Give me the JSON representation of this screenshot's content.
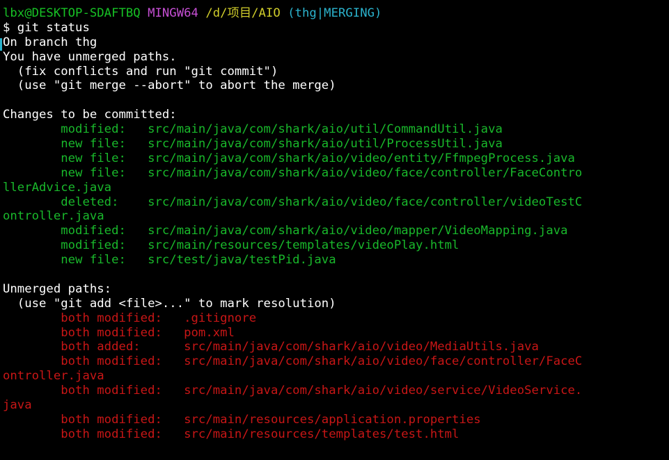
{
  "prompt": {
    "user_host": "lbx@DESKTOP-SDAFTBQ",
    "system": "MINGW64",
    "path": "/d/项目/AIO",
    "branch_status": "(thg|MERGING)"
  },
  "command": "$ git status",
  "info": [
    "On branch thg",
    "You have unmerged paths.",
    "  (fix conflicts and run \"git commit\")",
    "  (use \"git merge --abort\" to abort the merge)"
  ],
  "staged": {
    "heading": "Changes to be committed:",
    "lines": [
      "        modified:   src/main/java/com/shark/aio/util/CommandUtil.java",
      "        new file:   src/main/java/com/shark/aio/util/ProcessUtil.java",
      "        new file:   src/main/java/com/shark/aio/video/entity/FfmpegProcess.java",
      "        new file:   src/main/java/com/shark/aio/video/face/controller/FaceContro",
      "llerAdvice.java",
      "        deleted:    src/main/java/com/shark/aio/video/face/controller/videoTestC",
      "ontroller.java",
      "        modified:   src/main/java/com/shark/aio/video/mapper/VideoMapping.java",
      "        modified:   src/main/resources/templates/videoPlay.html",
      "        new file:   src/test/java/testPid.java"
    ]
  },
  "unmerged": {
    "heading": "Unmerged paths:",
    "hint": "  (use \"git add <file>...\" to mark resolution)",
    "lines": [
      "        both modified:   .gitignore",
      "        both modified:   pom.xml",
      "        both added:      src/main/java/com/shark/aio/video/MediaUtils.java",
      "        both modified:   src/main/java/com/shark/aio/video/face/controller/FaceC",
      "ontroller.java",
      "        both modified:   src/main/java/com/shark/aio/video/service/VideoService.",
      "java",
      "        both modified:   src/main/resources/application.properties",
      "        both modified:   src/main/resources/templates/test.html"
    ]
  },
  "colors": {
    "background": "#000000",
    "prompt_user": "#17c125",
    "prompt_system": "#c64fd4",
    "prompt_path": "#cfcc2b",
    "prompt_branch": "#2bb2cc",
    "text": "#ffffff",
    "staged": "#19b82b",
    "unmerged": "#c81616"
  }
}
